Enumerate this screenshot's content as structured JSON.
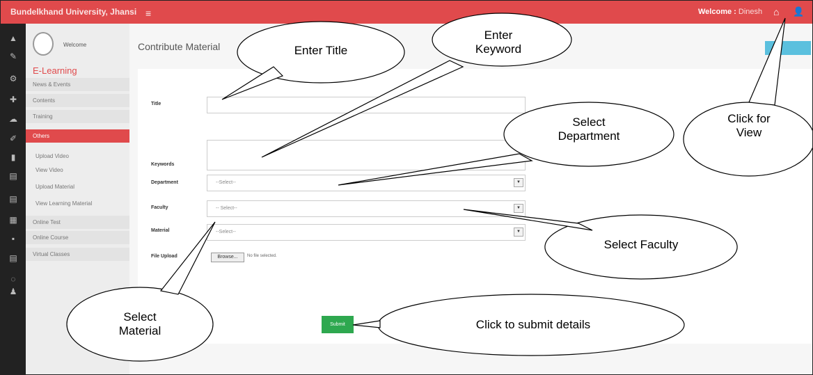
{
  "topbar": {
    "brand": "Bundelkhand University, Jhansi",
    "menu_icon": "hamburger-icon",
    "welcome_label": "Welcome :",
    "username": "Dinesh",
    "home_icon": "home-icon",
    "user_icon": "user-icon"
  },
  "iconbar": [
    "user-icon",
    "pen-icon",
    "gear-icon",
    "wrench-icon",
    "cloud-icon",
    "edit-icon",
    "book-icon",
    "calendar-icon",
    "calendar-icon",
    "list-icon",
    "chat-icon",
    "calendar-icon",
    "clock-icon",
    "user-icon"
  ],
  "sidebar": {
    "welcome": "Welcome",
    "title": "E-Learning",
    "items": [
      {
        "label": "News & Events"
      },
      {
        "label": "Contents"
      },
      {
        "label": "Training"
      },
      {
        "label": "Others"
      },
      {
        "label": "Upload Video"
      },
      {
        "label": "View Video"
      },
      {
        "label": "Upload Material"
      },
      {
        "label": "View Learning Material"
      },
      {
        "label": "Online Test"
      },
      {
        "label": "Online Course"
      },
      {
        "label": "Virtual Classes"
      }
    ]
  },
  "main": {
    "title": "Contribute Material",
    "form": {
      "title_label": "Title",
      "keywords_label": "Keywords",
      "department_label": "Department",
      "department_value": "--Select--",
      "faculty_label": "Faculty",
      "faculty_value": "-- Select--",
      "material_label": "Material",
      "material_value": "--Select--",
      "file_label": "File Upload",
      "browse_label": "Browse...",
      "no_file": "No file selected.",
      "submit_label": "Submit"
    }
  },
  "callouts": {
    "enter_title": "Enter Title",
    "enter_keyword": "Enter Keyword",
    "select_department": "Select Department",
    "click_for_view": "Click for View",
    "select_faculty": "Select Faculty",
    "select_material": "Select Material",
    "click_to_submit": "Click to submit details"
  }
}
